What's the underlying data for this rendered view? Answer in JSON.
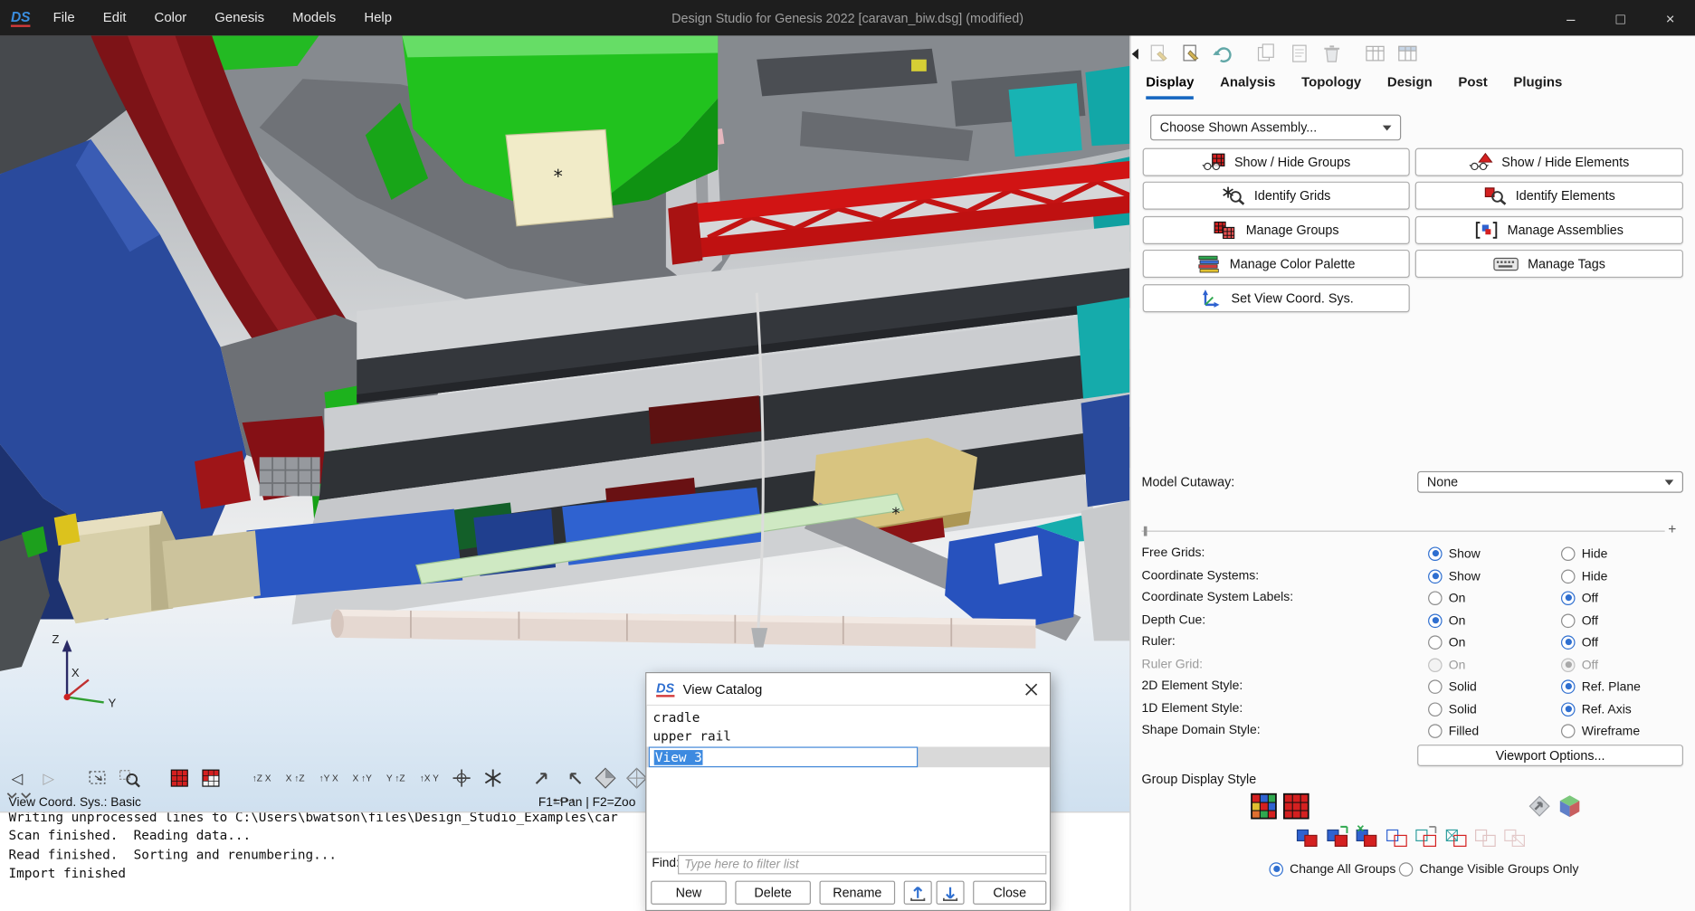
{
  "titlebar": {
    "logo": "DS",
    "menus": [
      "File",
      "Edit",
      "Color",
      "Genesis",
      "Models",
      "Help"
    ],
    "title": "Design Studio for Genesis 2022 [caravan_biw.dsg] (modified)",
    "window_controls": {
      "minimize": "–",
      "maximize": "□",
      "close": "×"
    }
  },
  "viewport": {
    "triad": {
      "x": "X",
      "y": "Y",
      "z": "Z"
    },
    "markers": [
      "*",
      "*"
    ],
    "toolbar": {
      "prev": "◁",
      "next": "▷",
      "axis_views": [
        "↑Z X",
        "X ↑Z",
        "↑Y X",
        "X ↑Y",
        "Y ↑Z",
        "↑X Y"
      ]
    },
    "status_left": "View Coord. Sys.: Basic",
    "status_hint": "F1=Pan | F2=Zoo"
  },
  "console": {
    "lines": [
      "Writing unprocessed lines to C:\\Users\\bwatson\\files\\Design_Studio_Examples\\car",
      "Scan finished.  Reading data...",
      "Read finished.  Sorting and renumbering...",
      "Import finished"
    ]
  },
  "right_panel": {
    "tabs": [
      "Display",
      "Analysis",
      "Topology",
      "Design",
      "Post",
      "Plugins"
    ],
    "active_tab": "Display",
    "assembly_combo": "Choose Shown Assembly...",
    "buttons_left": [
      "Show / Hide Groups",
      "Identify Grids",
      "Manage Groups",
      "Manage Color Palette",
      "Set View Coord. Sys."
    ],
    "buttons_right": [
      "Show / Hide Elements",
      "Identify Elements",
      "Manage Assemblies",
      "Manage Tags"
    ],
    "cutaway_label": "Model Cutaway:",
    "cutaway_value": "None",
    "zoom_plus": "+",
    "settings": [
      {
        "label": "Free Grids:",
        "opt1": "Show",
        "opt2": "Hide",
        "selected": 1,
        "disabled": false
      },
      {
        "label": "Coordinate Systems:",
        "opt1": "Show",
        "opt2": "Hide",
        "selected": 1,
        "disabled": false
      },
      {
        "label": "Coordinate System Labels:",
        "opt1": "On",
        "opt2": "Off",
        "selected": 2,
        "disabled": false
      },
      {
        "label": "Depth Cue:",
        "opt1": "On",
        "opt2": "Off",
        "selected": 1,
        "disabled": false
      },
      {
        "label": "Ruler:",
        "opt1": "On",
        "opt2": "Off",
        "selected": 2,
        "disabled": false
      },
      {
        "label": "Ruler Grid:",
        "opt1": "On",
        "opt2": "Off",
        "selected": 2,
        "disabled": true
      },
      {
        "label": "2D Element Style:",
        "opt1": "Solid",
        "opt2": "Ref. Plane",
        "selected": 2,
        "disabled": false
      },
      {
        "label": "1D Element Style:",
        "opt1": "Solid",
        "opt2": "Ref. Axis",
        "selected": 2,
        "disabled": false
      },
      {
        "label": "Shape Domain Style:",
        "opt1": "Filled",
        "opt2": "Wireframe",
        "selected": 0,
        "disabled": false
      }
    ],
    "viewport_options": "Viewport Options...",
    "group_display": {
      "title": "Group Display Style",
      "radio1": "Change All Groups",
      "radio2": "Change Visible Groups Only"
    }
  },
  "dialog": {
    "logo": "DS",
    "title": "View Catalog",
    "items": [
      "cradle",
      "upper rail"
    ],
    "edit_value": "View 3",
    "find_label": "Find:",
    "find_placeholder": "Type here to filter list",
    "buttons": {
      "new": "New",
      "delete": "Delete",
      "rename": "Rename",
      "close": "Close"
    }
  }
}
